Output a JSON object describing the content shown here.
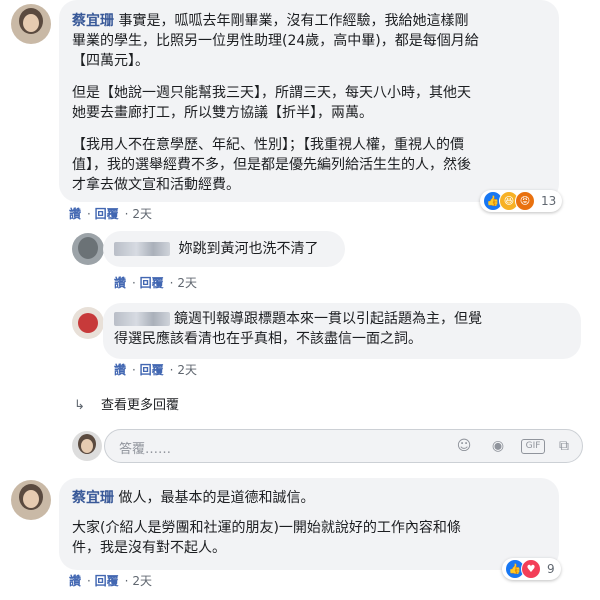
{
  "comment1": {
    "author": "蔡宜珊",
    "lines": [
      "事實是，呱呱去年剛畢業，沒有工作經驗，我給她這樣剛",
      "畢業的學生，比照另一位男性助理(24歲，高中畢)，都是每個月給",
      "【四萬元】。"
    ],
    "para2": [
      "但是【她說一週只能幫我三天】，所謂三天，每天八小時，其他天",
      "她要去畫廊打工，所以雙方協議【折半】，兩萬。"
    ],
    "para3": [
      "【我用人不在意學歷、年紀、性別】；【我重視人權，重視人的價",
      "值】，我的選舉經費不多，但是都是優先編列給活生生的人，然後",
      "才拿去做文宣和活動經費。"
    ],
    "actions": {
      "like": "讚",
      "reply": "回覆",
      "time": "2天"
    },
    "reaction_count": "13"
  },
  "reply1": {
    "text": "妳跳到黃河也洗不清了",
    "actions": {
      "like": "讚",
      "reply": "回覆",
      "time": "2天"
    }
  },
  "reply2": {
    "lines": [
      "鏡週刊報導跟標題本來一貫以引起話題為主，但覺",
      "得選民應該看清也在乎真相，不該盡信一面之詞。"
    ],
    "actions": {
      "like": "讚",
      "reply": "回覆",
      "time": "2天"
    }
  },
  "more_replies": "查看更多回覆",
  "reply_input": {
    "placeholder": "答覆……"
  },
  "comment2": {
    "author": "蔡宜珊",
    "line1": "做人，最基本的是道德和誠信。",
    "para2": [
      "大家(介紹人是勞團和社運的朋友)一開始就說好的工作內容和條",
      "件，我是沒有對不起人。"
    ],
    "actions": {
      "like": "讚",
      "reply": "回覆",
      "time": "2天"
    },
    "reaction_count": "9"
  },
  "colors": {
    "link": "#385898",
    "bubble": "#f2f3f5",
    "like_blue": "#1877f2",
    "heart_red": "#f33e58"
  }
}
